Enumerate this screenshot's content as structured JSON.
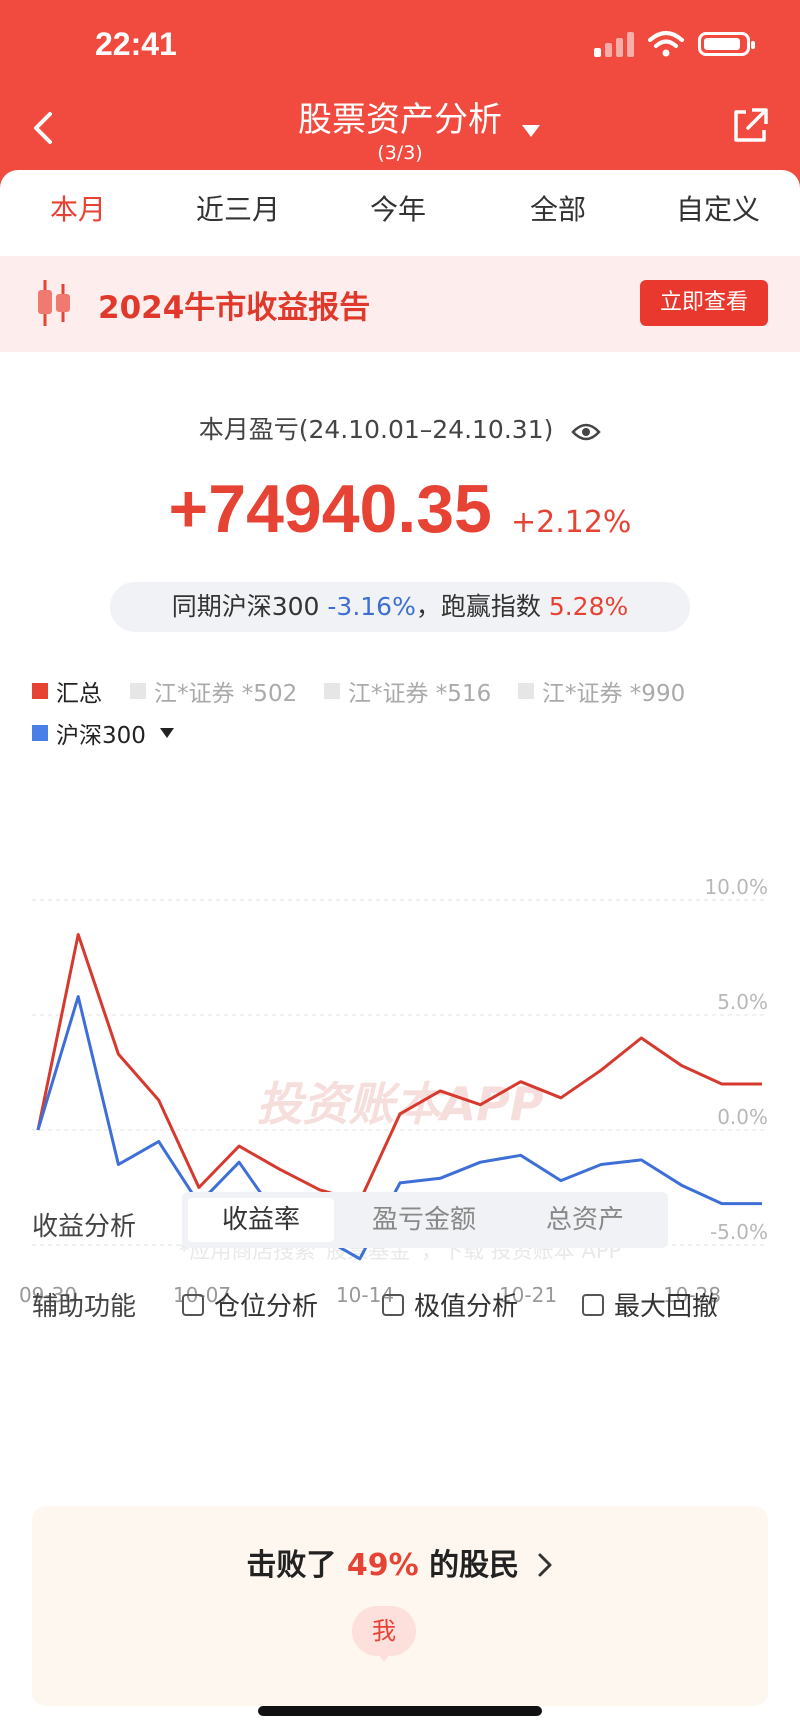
{
  "status": {
    "time": "22:41"
  },
  "header": {
    "title": "股票资产分析",
    "subtitle": "(3/3)"
  },
  "tabs": [
    "本月",
    "近三月",
    "今年",
    "全部",
    "自定义"
  ],
  "banner": {
    "text": "2024牛市收益报告",
    "button": "立即查看"
  },
  "summary": {
    "period": "本月盈亏(24.10.01–24.10.31)",
    "profit": "+74940.35",
    "profit_pct": "+2.12%",
    "compare_prefix": "同期沪深300",
    "compare_index": "-3.16%",
    "compare_mid": "，跑赢指数",
    "compare_beat": "5.28%"
  },
  "legend": {
    "items": [
      "汇总",
      "江*证券 *502",
      "江*证券 *516",
      "江*证券 *990",
      "沪深300"
    ],
    "colors": [
      "#e64335",
      "#e6e6e6",
      "#e6e6e6",
      "#e6e6e6",
      "#4a7fe8"
    ]
  },
  "chart_data": {
    "type": "line",
    "x": [
      "09-30",
      "10-08",
      "10-09",
      "10-10",
      "10-11",
      "10-14",
      "10-15",
      "10-16",
      "10-17",
      "10-18",
      "10-21",
      "10-22",
      "10-23",
      "10-24",
      "10-25",
      "10-28",
      "10-29",
      "10-30",
      "10-31"
    ],
    "xticks": [
      "09-30",
      "10-07",
      "10-14",
      "10-21",
      "10-28"
    ],
    "yticks": [
      "10.0%",
      "5.0%",
      "0.0%",
      "-5.0%",
      "-10.0%"
    ],
    "ylim": [
      -10,
      10
    ],
    "series": [
      {
        "name": "汇总",
        "color": "#d63a2f",
        "values": [
          0,
          8.5,
          3.3,
          1.3,
          -2.5,
          -0.7,
          -1.7,
          -2.6,
          -3.1,
          0.7,
          1.7,
          1.1,
          2.1,
          1.4,
          2.6,
          4.0,
          2.8,
          2.0,
          2.0
        ]
      },
      {
        "name": "沪深300",
        "color": "#3e6fd6",
        "values": [
          0,
          5.8,
          -1.5,
          -0.5,
          -3.2,
          -1.4,
          -3.9,
          -4.6,
          -5.6,
          -2.3,
          -2.1,
          -1.4,
          -1.1,
          -2.2,
          -1.5,
          -1.3,
          -2.4,
          -3.2,
          -3.2
        ]
      }
    ],
    "watermark": "投资账本APP",
    "footnote": "*应用商店搜索“股票基金”，下载 投资账本 APP"
  },
  "analysis": {
    "label": "收益分析",
    "options": [
      "收益率",
      "盈亏金额",
      "总资产"
    ]
  },
  "aux": {
    "label": "辅助功能",
    "options": [
      "仓位分析",
      "极值分析",
      "最大回撤"
    ]
  },
  "beat": {
    "prefix": "击败了",
    "pct": "49%",
    "suffix": "的股民",
    "badge": "我"
  }
}
